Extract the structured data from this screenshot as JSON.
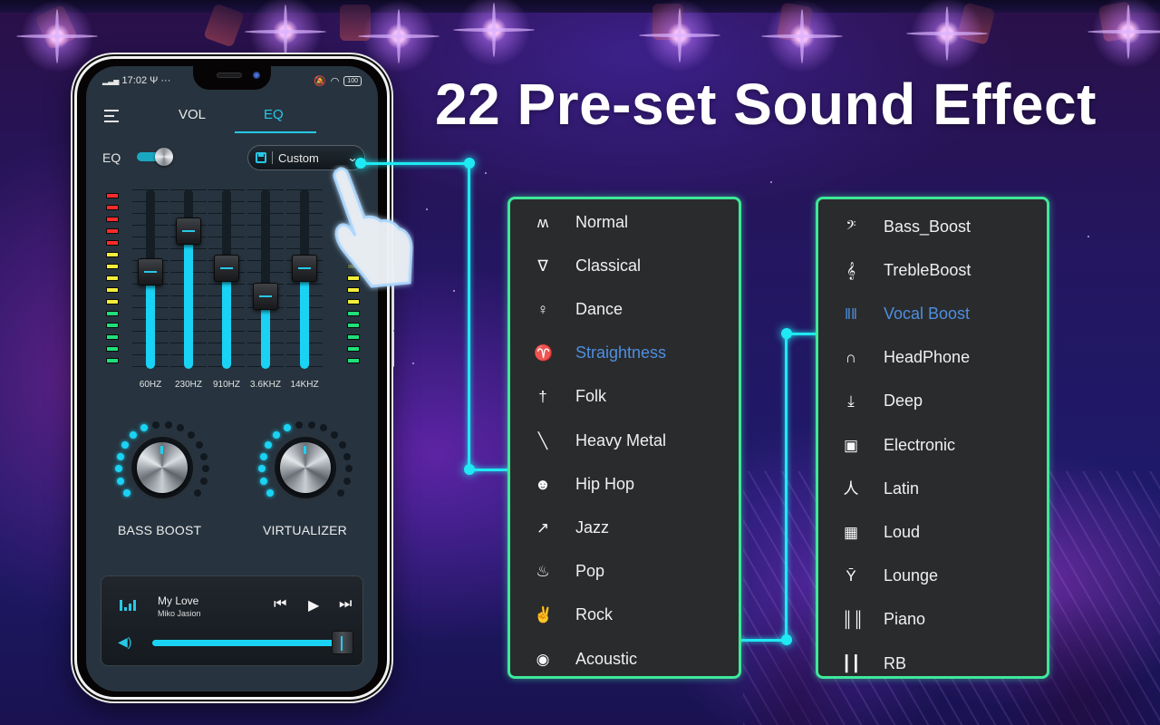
{
  "headline": "22 Pre-set Sound Effect",
  "phone": {
    "status_bar": {
      "time": "17:02",
      "left_extra": "Ψ ···",
      "battery": "100"
    },
    "tabs": [
      {
        "label": "VOL",
        "active": false
      },
      {
        "label": "EQ",
        "active": true
      }
    ],
    "eq_toggle": {
      "label": "EQ",
      "on": true
    },
    "preset_select": {
      "value": "Custom",
      "icon": "save-icon"
    },
    "bands": [
      {
        "label": "60HZ",
        "level": 0.52
      },
      {
        "label": "230HZ",
        "level": 0.76
      },
      {
        "label": "910HZ",
        "level": 0.54
      },
      {
        "label": "3.6KHZ",
        "level": 0.38
      },
      {
        "label": "14KHZ",
        "level": 0.54
      }
    ],
    "dials": [
      {
        "label": "BASS BOOST",
        "active_dots": 7,
        "total_dots": 16
      },
      {
        "label": "VIRTUALIZER",
        "active_dots": 7,
        "total_dots": 16
      }
    ],
    "player": {
      "title": "My Love",
      "artist": "Miko Jasion",
      "prev": "⏮",
      "play": "▶",
      "next": "⏭",
      "volume_icon": "🔊",
      "volume": 0.95
    }
  },
  "presets_left": [
    {
      "label": "Normal",
      "icon": "normal-wave-icon",
      "glyph": "ʍ",
      "active": false
    },
    {
      "label": "Classical",
      "icon": "harp-icon",
      "glyph": "∇",
      "active": false
    },
    {
      "label": "Dance",
      "icon": "dancer-icon",
      "glyph": "♀",
      "active": false
    },
    {
      "label": "Straightness",
      "icon": "straightness-icon",
      "glyph": "♈",
      "active": true
    },
    {
      "label": "Folk",
      "icon": "folk-instrument-icon",
      "glyph": "†",
      "active": false
    },
    {
      "label": "Heavy Metal",
      "icon": "guitar-icon",
      "glyph": "╲",
      "active": false
    },
    {
      "label": "Hip Hop",
      "icon": "hiphop-face-icon",
      "glyph": "☻",
      "active": false
    },
    {
      "label": "Jazz",
      "icon": "trumpet-icon",
      "glyph": "↗",
      "active": false
    },
    {
      "label": "Pop",
      "icon": "flame-icon",
      "glyph": "♨",
      "active": false
    },
    {
      "label": "Rock",
      "icon": "rock-hand-icon",
      "glyph": "✌",
      "active": false
    },
    {
      "label": "Acoustic",
      "icon": "disc-icon",
      "glyph": "◉",
      "active": false
    }
  ],
  "presets_right": [
    {
      "label": "Bass_Boost",
      "icon": "bass-clef-icon",
      "glyph": "𝄢",
      "active": false
    },
    {
      "label": "TrebleBoost",
      "icon": "treble-clef-icon",
      "glyph": "𝄞",
      "active": false
    },
    {
      "label": "Vocal Boost",
      "icon": "vocal-wave-icon",
      "glyph": "‖‖",
      "active": true
    },
    {
      "label": "HeadPhone",
      "icon": "headphone-icon",
      "glyph": "∩",
      "active": false
    },
    {
      "label": "Deep",
      "icon": "download-deep-icon",
      "glyph": "⤓",
      "active": false
    },
    {
      "label": "Electronic",
      "icon": "electronic-icon",
      "glyph": "▣",
      "active": false
    },
    {
      "label": "Latin",
      "icon": "latin-dancer-icon",
      "glyph": "⼈",
      "active": false
    },
    {
      "label": "Loud",
      "icon": "speaker-icon",
      "glyph": "▦",
      "active": false
    },
    {
      "label": "Lounge",
      "icon": "cocktail-icon",
      "glyph": "Ȳ",
      "active": false
    },
    {
      "label": "Piano",
      "icon": "piano-icon",
      "glyph": "║║",
      "active": false
    },
    {
      "label": "RB",
      "icon": "bars-icon",
      "glyph": "┃┃",
      "active": false
    }
  ],
  "colors": {
    "accent": "#27c8e6",
    "panel_border": "#3ee89a",
    "active_preset": "#4e8fe0",
    "connector": "#1fe9f2"
  }
}
